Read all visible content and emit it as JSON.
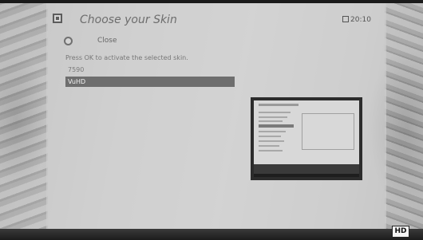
{
  "header": {
    "title": "Choose your Skin",
    "time": "20:10"
  },
  "close_button": {
    "label": "Close"
  },
  "instruction": "Press OK to activate the selected skin.",
  "skins": [
    {
      "label": "7590",
      "selected": false
    },
    {
      "label": "VuHD",
      "selected": true
    }
  ],
  "preview": {
    "icon": "skin-preview-thumbnail"
  },
  "badge": {
    "label": "HD"
  },
  "colors": {
    "selection": "#6e6e6e",
    "title_text": "#6d6d6d",
    "panel": "#cdcdcd"
  }
}
